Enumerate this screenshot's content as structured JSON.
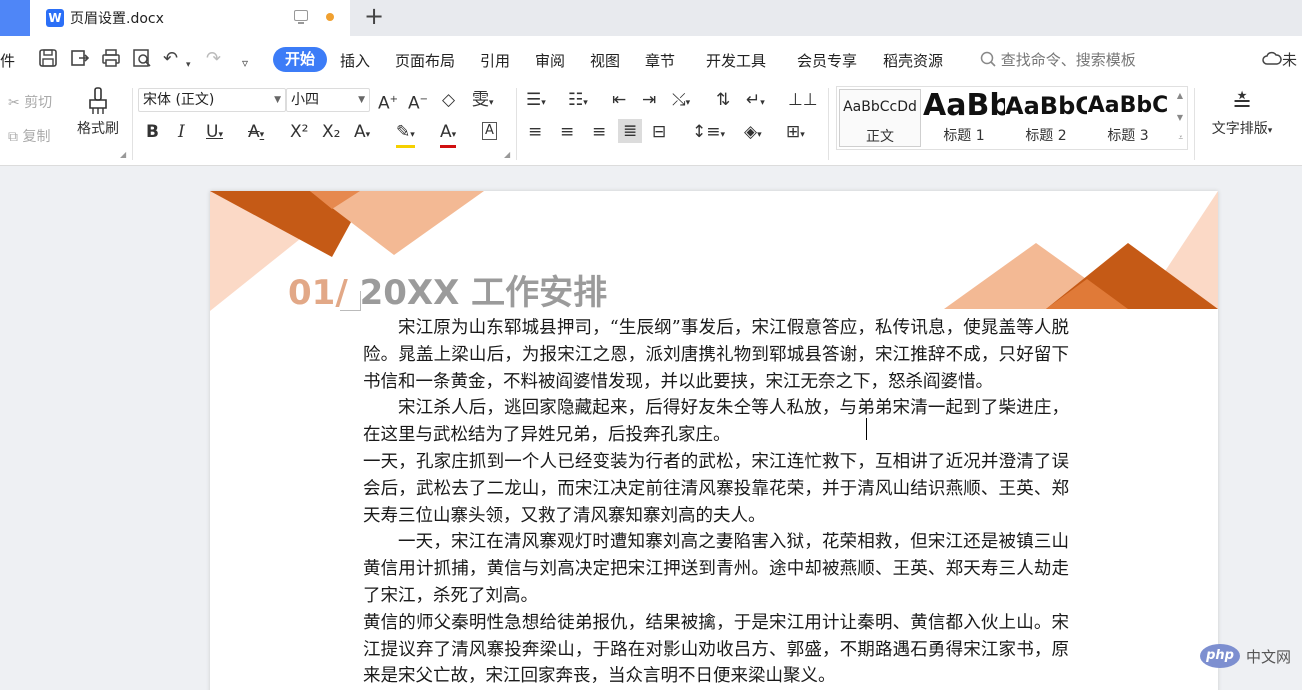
{
  "tabbar": {
    "doc_title": "页眉设置.docx",
    "word_icon": "W",
    "new_tab": "+"
  },
  "menubar": {
    "file_partial": "件",
    "start": "开始",
    "items": [
      "插入",
      "页面布局",
      "引用",
      "审阅",
      "视图",
      "章节",
      "开发工具",
      "会员专享",
      "稻壳资源"
    ],
    "search_placeholder": "查找命令、搜索模板",
    "cloud_partial": "未"
  },
  "ribbon": {
    "cut": "剪切",
    "copy": "复制",
    "format_painter": "格式刷",
    "font_name": "宋体 (正文)",
    "font_size": "小四",
    "styles": [
      {
        "preview": "AaBbCcDd",
        "label": "正文"
      },
      {
        "preview": "AaBb",
        "label": "标题 1"
      },
      {
        "preview": "AaBbC",
        "label": "标题 2"
      },
      {
        "preview": "AaBbC",
        "label": "标题 3"
      }
    ],
    "text_layout": "文字排版"
  },
  "document": {
    "heading_number": "01/",
    "heading_text": " 20XX 工作安排",
    "paragraphs": [
      "宋江原为山东郓城县押司，“生辰纲”事发后，宋江假意答应，私传讯息，使晁盖等人脱险。晁盖上梁山后，为报宋江之恩，派刘唐携礼物到郓城县答谢，宋江推辞不成，只好留下书信和一条黄金，不料被阎婆惜发现，并以此要挟，宋江无奈之下，怒杀阎婆惜。",
      "宋江杀人后，逃回家隐藏起来，后得好友朱仝等人私放，与弟弟宋清一起到了柴进庄，在这里与武松结为了异姓兄弟，后投奔孔家庄。",
      "一天，孔家庄抓到一个人已经变装为行者的武松，宋江连忙救下，互相讲了近况并澄清了误会后，武松去了二龙山，而宋江决定前往清风寨投靠花荣，并于清风山结识燕顺、王英、郑天寿三位山寨头领，又救了清风寨知寨刘高的夫人。",
      "一天，宋江在清风寨观灯时遭知寨刘高之妻陷害入狱，花荣相救，但宋江还是被镇三山黄信用计抓捕，黄信与刘高决定把宋江押送到青州。途中却被燕顺、王英、郑天寿三人劫走了宋江，杀死了刘高。",
      "黄信的师父秦明性急想给徒弟报仇，结果被擒，于是宋江用计让秦明、黄信都入伙上山。宋江提议弃了清风寨投奔梁山，于路在对影山劝收吕方、郭盛，不期路遇石勇得宋江家书，原来是宋父亡故，宋江回家奔丧，当众言明不日便来梁山聚义。"
    ]
  },
  "watermark": {
    "logo": "php",
    "text": "中文网"
  },
  "colors": {
    "accent": "#3c7cf7",
    "deco_dark": "#c55a16",
    "deco_light": "#f3b994",
    "deco_pale": "#fbd9c6"
  }
}
